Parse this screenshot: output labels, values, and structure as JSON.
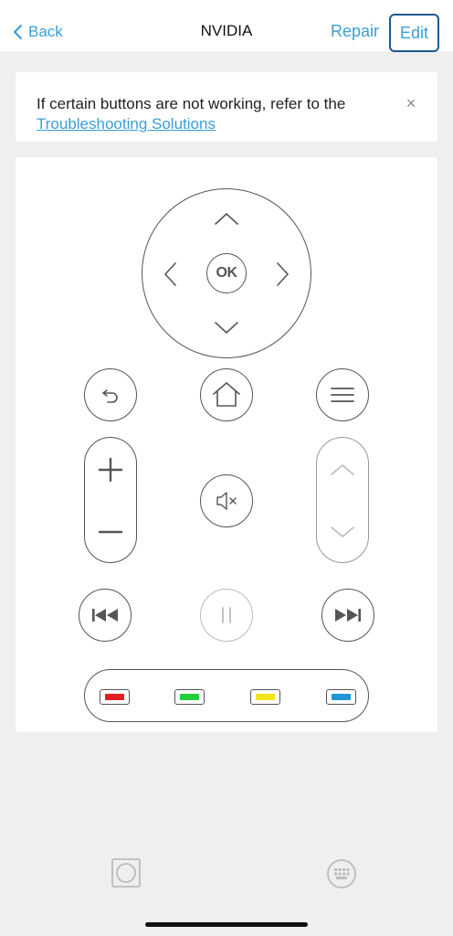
{
  "nav": {
    "back_label": "Back",
    "title": "NVIDIA",
    "repair_label": "Repair",
    "edit_label": "Edit"
  },
  "banner": {
    "text": "If certain buttons are not working, refer to the",
    "link": "Troubleshooting Solutions",
    "close_glyph": "×"
  },
  "remote": {
    "ok_label": "OK",
    "color_keys": [
      {
        "name": "red",
        "color": "#e02020"
      },
      {
        "name": "green",
        "color": "#22d13a"
      },
      {
        "name": "yellow",
        "color": "#f2e51c"
      },
      {
        "name": "blue",
        "color": "#1f97d6"
      }
    ]
  },
  "colors": {
    "accent": "#3a9ed8",
    "edit_border": "#1e5a8c",
    "icon_stroke": "#555555",
    "disabled": "#bbbbbb"
  }
}
